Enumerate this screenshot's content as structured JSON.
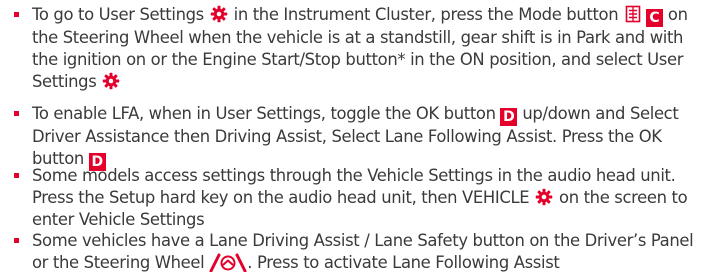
{
  "accent_color": "#e4002b",
  "items": [
    {
      "t1": "To go to User Settings",
      "t2": "in the Instrument Cluster, press the Mode button",
      "badge": "C",
      "t3": "on the Steering Wheel when the vehicle is at a standstill, gear shift is in Park and with the ignition on or the Engine Start/Stop button* in the ON position, and select User Settings"
    },
    {
      "t1": "To enable LFA, when in User Settings, toggle the OK button",
      "badge1": "D",
      "t2": "up/down and Select Driver Assistance then Driving Assist, Select Lane Following Assist. Press the OK button",
      "badge2": "D"
    },
    {
      "t1": "Some models access settings through the Vehicle Settings in the audio head unit. Press the Setup hard key on the audio head unit, then VEHICLE",
      "t2": "on the screen to enter Vehicle Settings"
    },
    {
      "t1": "Some vehicles have a Lane Driving Assist / Lane Safety button on the Driver’s Panel or the Steering Wheel",
      "t2": ". Press to activate Lane Following Assist"
    }
  ],
  "icons": {
    "settings": "gear-icon",
    "mode": "mode-button-icon",
    "lane": "lane-assist-icon"
  }
}
